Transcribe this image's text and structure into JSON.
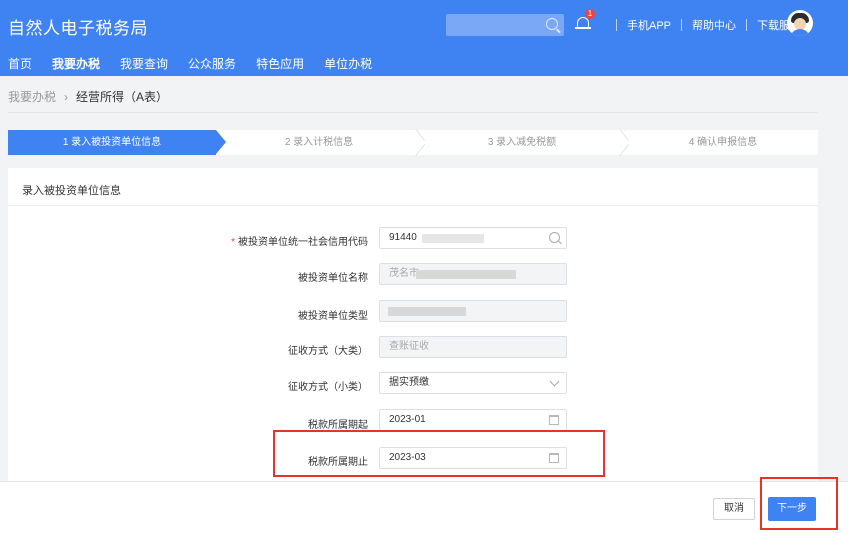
{
  "header": {
    "title": "自然人电子税务局",
    "search_placeholder": "",
    "notification_count": "1",
    "links": [
      "手机APP",
      "帮助中心",
      "下载服务"
    ]
  },
  "nav": [
    "首页",
    "我要办税",
    "我要查询",
    "公众服务",
    "特色应用",
    "单位办税"
  ],
  "breadcrumb": {
    "parent": "我要办税",
    "current": "经营所得（A表）"
  },
  "steps": [
    {
      "label": "1  录入被投资单位信息"
    },
    {
      "label": "2  录入计税信息"
    },
    {
      "label": "3  录入减免税额"
    },
    {
      "label": "4  确认申报信息"
    }
  ],
  "panel": {
    "title": "录入被投资单位信息"
  },
  "form": {
    "credit_code": {
      "label": "被投资单位统一社会信用代码",
      "value": "91440"
    },
    "unit_name": {
      "label": "被投资单位名称",
      "value": "茂名市"
    },
    "unit_type": {
      "label": "被投资单位类型",
      "value": ""
    },
    "collect_major": {
      "label": "征收方式（大类）",
      "value": "查账征收"
    },
    "collect_minor": {
      "label": "征收方式（小类）",
      "value": "据实预缴"
    },
    "period_start": {
      "label": "税款所属期起",
      "value": "2023-01"
    },
    "period_end": {
      "label": "税款所属期止",
      "value": "2023-03"
    }
  },
  "buttons": {
    "cancel": "取消",
    "next": "下一步"
  },
  "colors": {
    "primary": "#3f82f1",
    "highlight": "#e8332b"
  }
}
